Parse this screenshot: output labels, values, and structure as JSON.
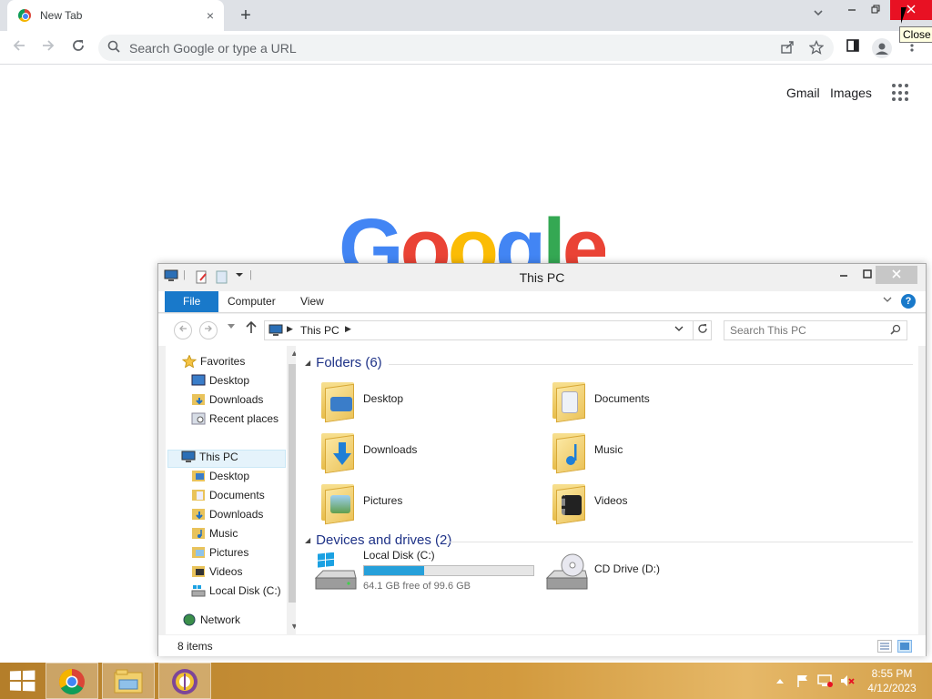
{
  "browser": {
    "tab_title": "New Tab",
    "tab_close": "×",
    "new_tab": "+",
    "omnibox_placeholder": "Search Google or type a URL",
    "links": [
      "Gmail",
      "Images"
    ],
    "logo_text": "Google",
    "logo_colors": [
      "#4285f4",
      "#ea4335",
      "#fbbc05",
      "#4285f4",
      "#34a853",
      "#ea4335"
    ],
    "tooltip": "Close",
    "icons": [
      "back-icon",
      "forward-icon",
      "reload-icon",
      "search-icon",
      "share-icon",
      "bookmark-star-icon",
      "side-panel-icon",
      "profile-icon",
      "kebab-menu-icon",
      "apps-grid-icon"
    ]
  },
  "explorer": {
    "title": "This PC",
    "ribbon_tabs": [
      "File",
      "Computer",
      "View"
    ],
    "address_crumb": "This PC",
    "search_placeholder": "Search This PC",
    "nav": {
      "favorites": {
        "label": "Favorites",
        "items": [
          "Desktop",
          "Downloads",
          "Recent places"
        ]
      },
      "this_pc": {
        "label": "This PC",
        "items": [
          "Desktop",
          "Documents",
          "Downloads",
          "Music",
          "Pictures",
          "Videos",
          "Local Disk (C:)"
        ]
      },
      "network": "Network"
    },
    "folders_header": "Folders (6)",
    "folders": [
      "Desktop",
      "Documents",
      "Downloads",
      "Music",
      "Pictures",
      "Videos"
    ],
    "devices_header": "Devices and drives (2)",
    "drives": [
      {
        "name": "Local Disk (C:)",
        "free_text": "64.1 GB free of 99.6 GB",
        "used_fraction": 0.356
      },
      {
        "name": "CD Drive (D:)"
      }
    ],
    "status": "8 items",
    "accent": "#1979ca"
  },
  "taskbar": {
    "time": "8:55 PM",
    "date": "4/12/2023",
    "apps": [
      "start-button",
      "chrome",
      "file-explorer",
      "tor-browser"
    ]
  }
}
